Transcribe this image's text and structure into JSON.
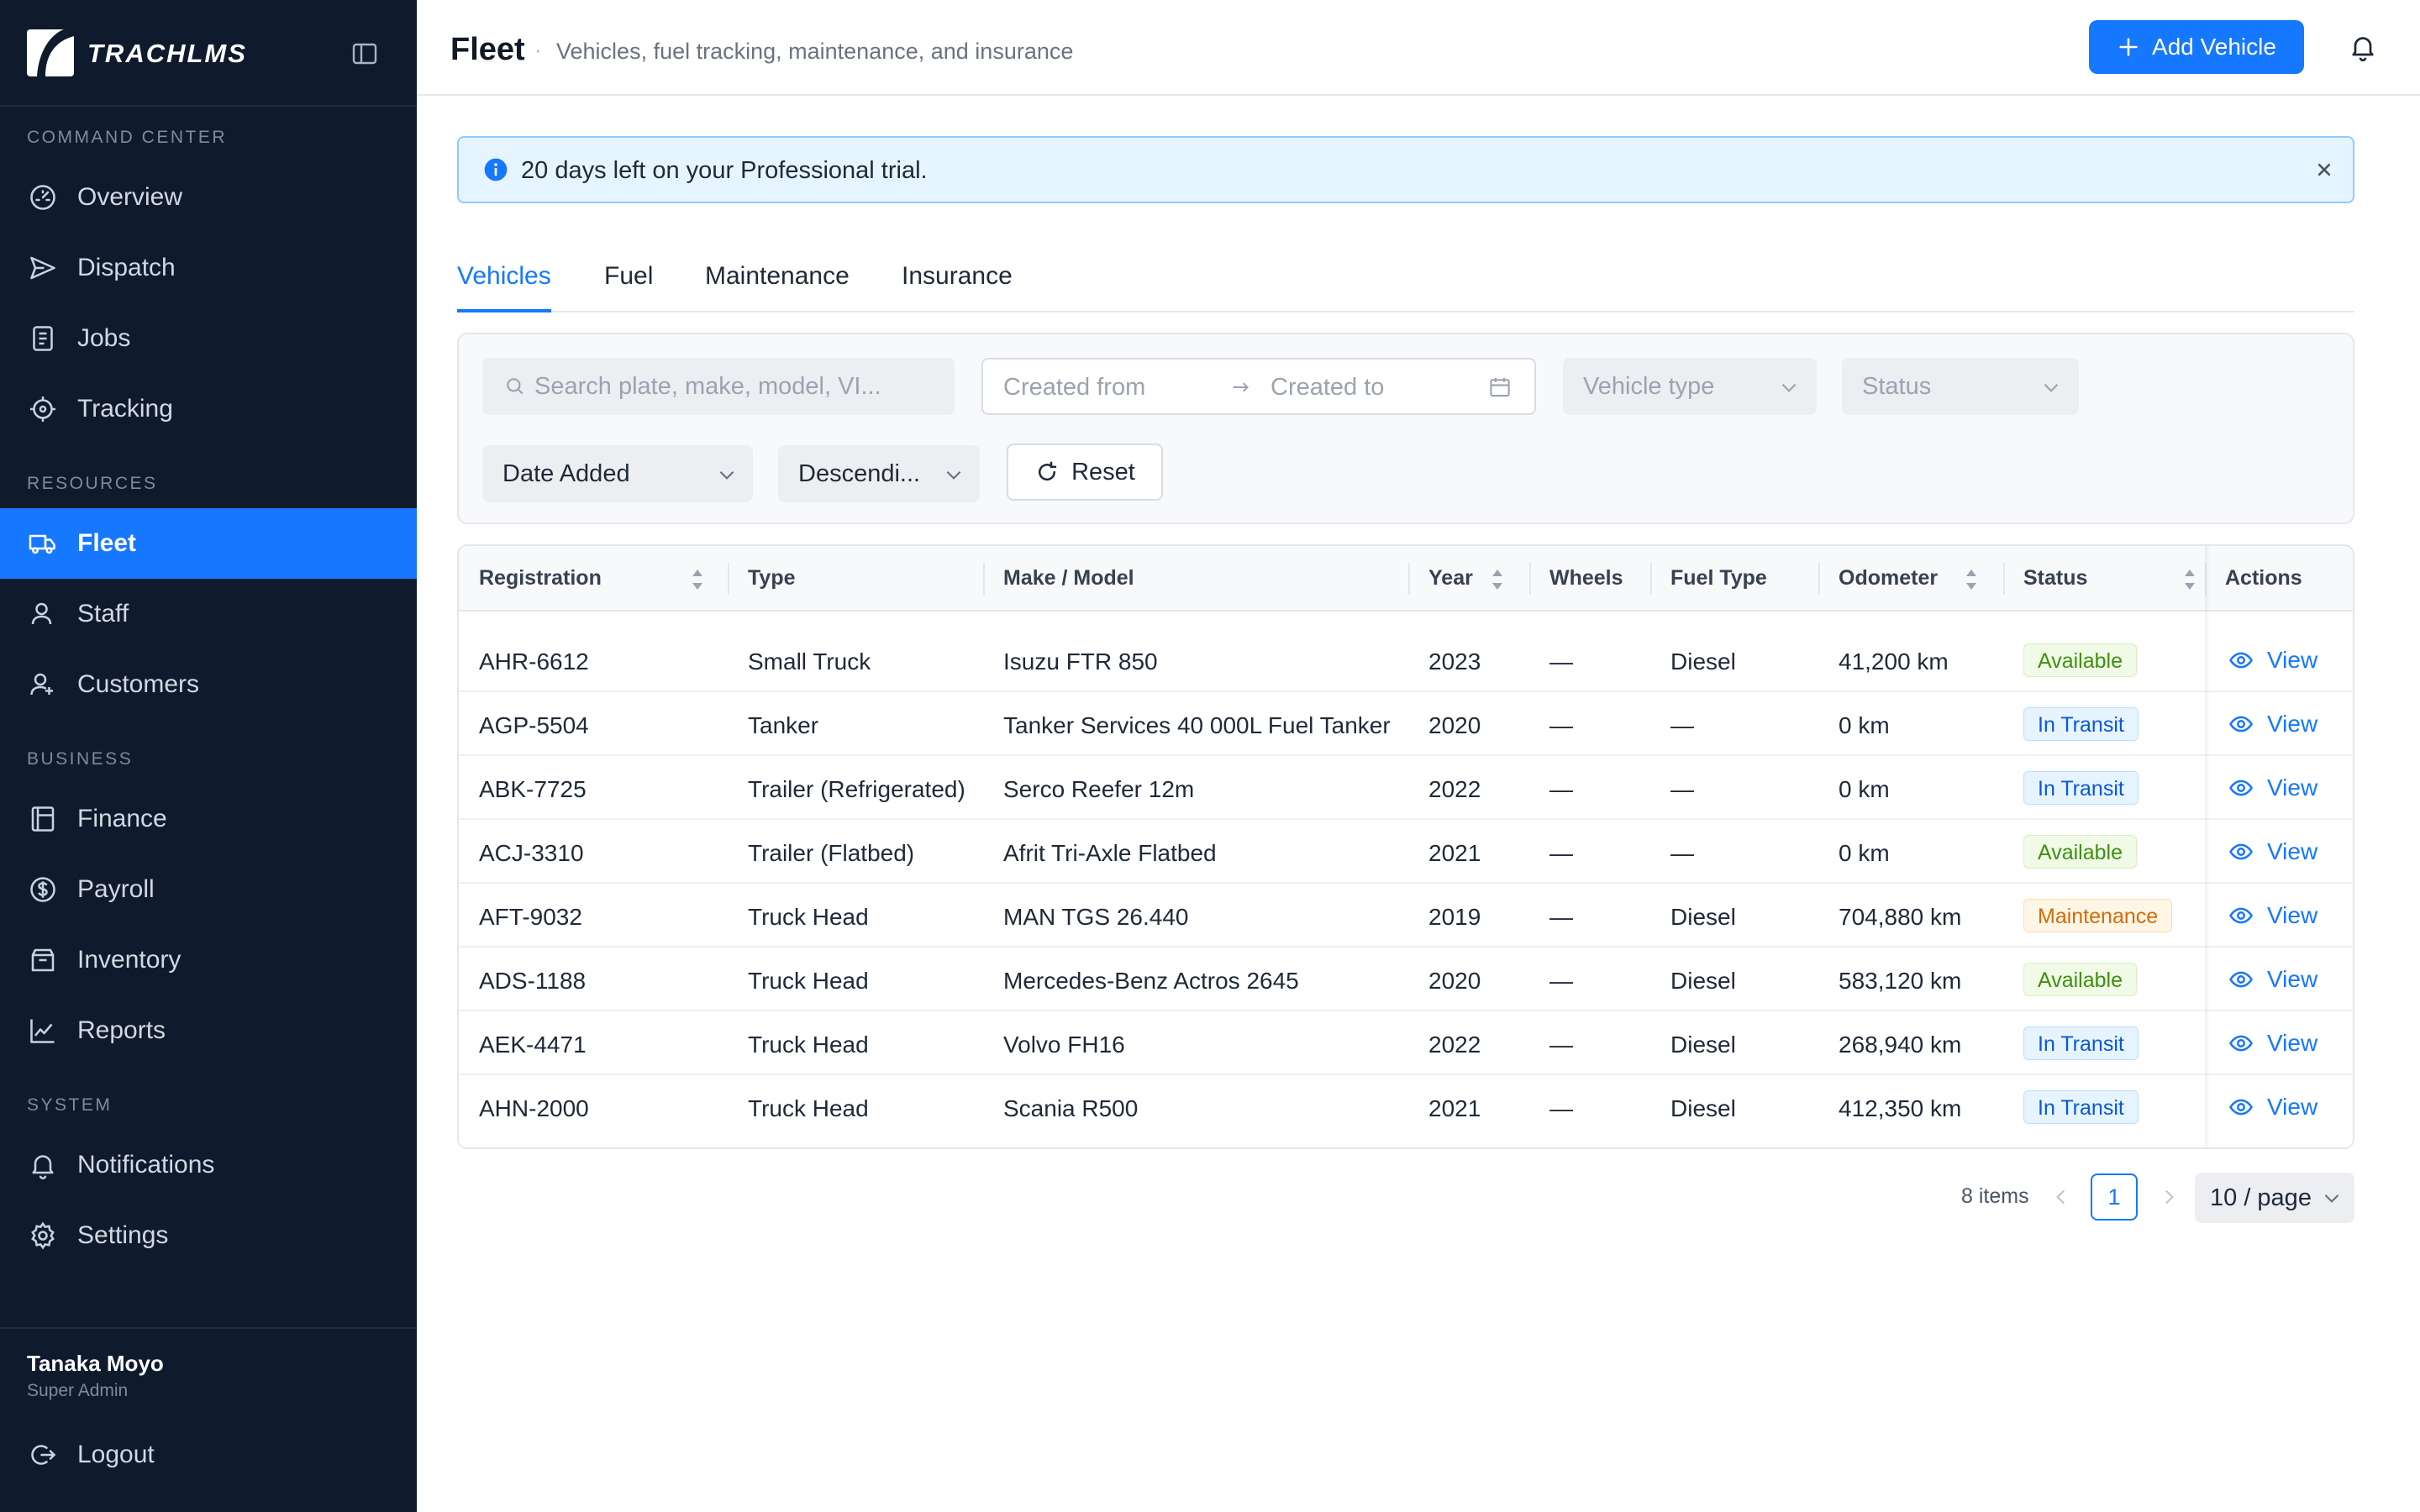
{
  "app": {
    "name": "TRACHLMS"
  },
  "sidebar": {
    "sections": {
      "command": "COMMAND CENTER",
      "resources": "RESOURCES",
      "business": "BUSINESS",
      "system": "SYSTEM"
    },
    "items": [
      {
        "label": "Overview",
        "icon": "gauge-icon"
      },
      {
        "label": "Dispatch",
        "icon": "send-icon"
      },
      {
        "label": "Jobs",
        "icon": "clipboard-icon"
      },
      {
        "label": "Tracking",
        "icon": "crosshair-icon"
      },
      {
        "label": "Fleet",
        "icon": "truck-icon",
        "active": true
      },
      {
        "label": "Staff",
        "icon": "user-icon"
      },
      {
        "label": "Customers",
        "icon": "users-icon"
      },
      {
        "label": "Finance",
        "icon": "ledger-icon"
      },
      {
        "label": "Payroll",
        "icon": "dollar-circle-icon"
      },
      {
        "label": "Inventory",
        "icon": "box-icon"
      },
      {
        "label": "Reports",
        "icon": "chart-line-icon"
      },
      {
        "label": "Notifications",
        "icon": "bell-icon"
      },
      {
        "label": "Settings",
        "icon": "gear-icon"
      }
    ],
    "user": {
      "name": "Tanaka Moyo",
      "role": "Super Admin"
    },
    "logout": "Logout"
  },
  "header": {
    "title": "Fleet",
    "separator": "·",
    "subtitle": "Vehicles, fuel tracking, maintenance, and insurance",
    "add_button": "Add Vehicle"
  },
  "banner": {
    "text": "20 days left on your Professional trial."
  },
  "tabs": [
    "Vehicles",
    "Fuel",
    "Maintenance",
    "Insurance"
  ],
  "filters": {
    "search_placeholder": "Search plate, make, model, VI...",
    "date_from_placeholder": "Created from",
    "date_to_placeholder": "Created to",
    "vehicle_type_placeholder": "Vehicle type",
    "status_placeholder": "Status",
    "sort_field": "Date Added",
    "sort_order": "Descendi...",
    "reset": "Reset"
  },
  "table": {
    "columns": [
      "Registration",
      "Type",
      "Make / Model",
      "Year",
      "Wheels",
      "Fuel Type",
      "Odometer",
      "Status",
      "Actions"
    ],
    "rows": [
      {
        "registration": "AHR-6612",
        "type": "Small Truck",
        "model": "Isuzu FTR 850",
        "year": "2023",
        "wheels": "—",
        "fuel": "Diesel",
        "odometer": "41,200 km",
        "status": "Available",
        "action": "View"
      },
      {
        "registration": "AGP-5504",
        "type": "Tanker",
        "model": "Tanker Services 40 000L Fuel Tanker",
        "year": "2020",
        "wheels": "—",
        "fuel": "—",
        "odometer": "0 km",
        "status": "In Transit",
        "action": "View"
      },
      {
        "registration": "ABK-7725",
        "type": "Trailer (Refrigerated)",
        "model": "Serco Reefer 12m",
        "year": "2022",
        "wheels": "—",
        "fuel": "—",
        "odometer": "0 km",
        "status": "In Transit",
        "action": "View"
      },
      {
        "registration": "ACJ-3310",
        "type": "Trailer (Flatbed)",
        "model": "Afrit Tri-Axle Flatbed",
        "year": "2021",
        "wheels": "—",
        "fuel": "—",
        "odometer": "0 km",
        "status": "Available",
        "action": "View"
      },
      {
        "registration": "AFT-9032",
        "type": "Truck Head",
        "model": "MAN TGS 26.440",
        "year": "2019",
        "wheels": "—",
        "fuel": "Diesel",
        "odometer": "704,880 km",
        "status": "Maintenance",
        "action": "View"
      },
      {
        "registration": "ADS-1188",
        "type": "Truck Head",
        "model": "Mercedes-Benz Actros 2645",
        "year": "2020",
        "wheels": "—",
        "fuel": "Diesel",
        "odometer": "583,120 km",
        "status": "Available",
        "action": "View"
      },
      {
        "registration": "AEK-4471",
        "type": "Truck Head",
        "model": "Volvo FH16",
        "year": "2022",
        "wheels": "—",
        "fuel": "Diesel",
        "odometer": "268,940 km",
        "status": "In Transit",
        "action": "View"
      },
      {
        "registration": "AHN-2000",
        "type": "Truck Head",
        "model": "Scania R500",
        "year": "2021",
        "wheels": "—",
        "fuel": "Diesel",
        "odometer": "412,350 km",
        "status": "In Transit",
        "action": "View"
      }
    ]
  },
  "pagination": {
    "total": "8 items",
    "current": "1",
    "page_size": "10 / page"
  },
  "colors": {
    "accent": "#1677ff",
    "sidebar_bg": "#0f1b2d",
    "available": "#3f8f12",
    "in_transit": "#0958d9",
    "maintenance": "#d46b08"
  }
}
